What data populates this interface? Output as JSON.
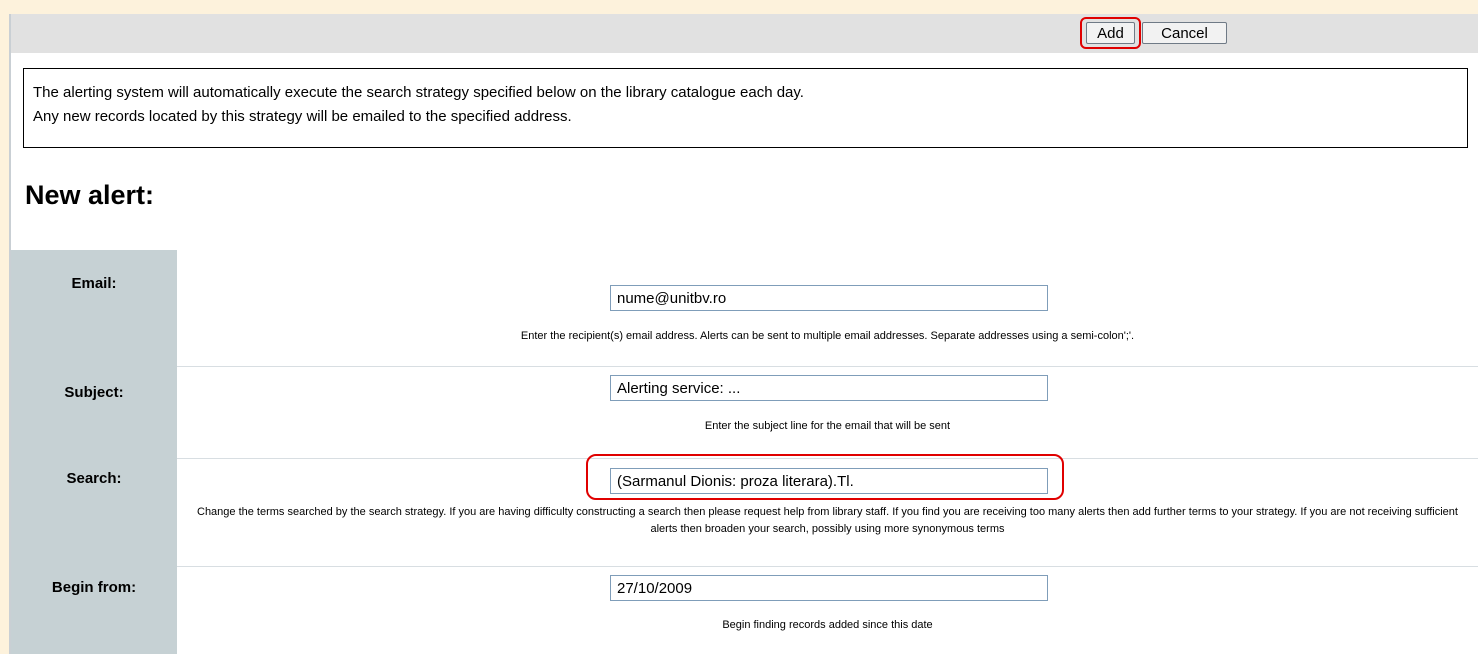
{
  "toolbar": {
    "add_label": "Add",
    "cancel_label": "Cancel"
  },
  "info": {
    "line1": "The alerting system will automatically execute the search strategy specified below on the library catalogue each day.",
    "line2": "Any new records located by this strategy will be emailed to the specified address."
  },
  "page_title": "New alert:",
  "form": {
    "email": {
      "label": "Email:",
      "value": "nume@unitbv.ro",
      "help": "Enter the recipient(s) email address. Alerts can be sent to multiple email addresses. Separate addresses using a semi-colon';'."
    },
    "subject": {
      "label": "Subject:",
      "value": "Alerting service: ...",
      "help": "Enter the subject line for the email that will be sent"
    },
    "search": {
      "label": "Search:",
      "value": "(Sarmanul Dionis: proza literara).Tl.",
      "help": "Change the terms searched by the search strategy. If you are having difficulty constructing a search then please request help from library staff. If you find you are receiving too many alerts then add further terms to your strategy. If you are not receiving sufficient alerts then broaden your search, possibly using more synonymous terms"
    },
    "begin_from": {
      "label": "Begin from:",
      "value": "27/10/2009",
      "help": "Begin finding records added since this date"
    }
  },
  "colors": {
    "highlight": "#e00000",
    "toolbar_bg": "#e1e1e1",
    "label_col_bg": "#c6d1d4",
    "page_frame": "#fdf2dc"
  }
}
